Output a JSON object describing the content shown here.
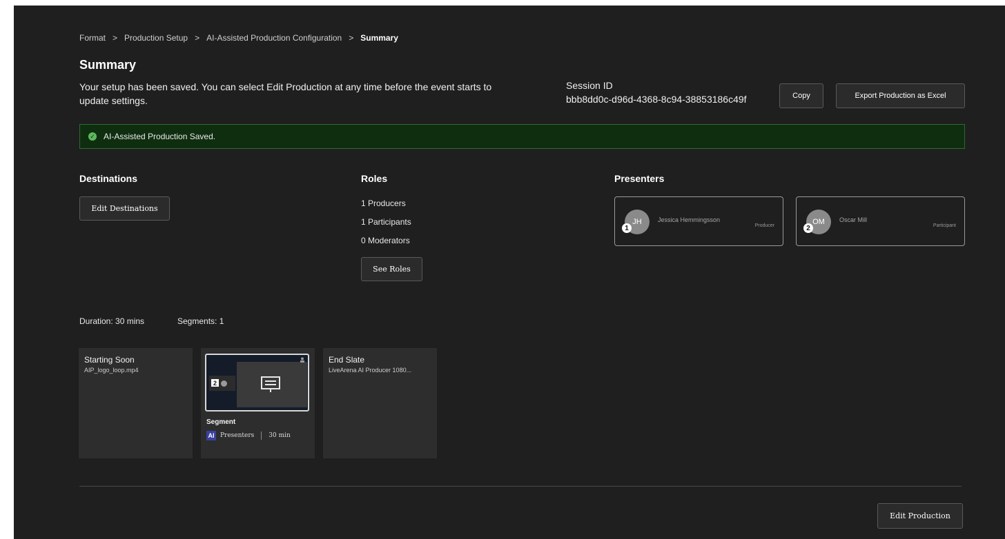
{
  "breadcrumb": [
    "Format",
    "Production Setup",
    "AI-Assisted Production Configuration",
    "Summary"
  ],
  "breadcrumb_separator": ">",
  "page_title": "Summary",
  "intro_text": "Your setup has been saved. You can select Edit Production at any time before the event starts to update settings.",
  "session": {
    "label": "Session ID",
    "id": "bbb8dd0c-d96d-4368-8c94-38853186c49f",
    "copy_label": "Copy",
    "export_label": "Export Production as Excel"
  },
  "banner": {
    "text": "AI-Assisted Production Saved.",
    "color": "#5fb85f"
  },
  "destinations": {
    "title": "Destinations",
    "edit_label": "Edit Destinations"
  },
  "roles": {
    "title": "Roles",
    "lines": [
      "1 Producers",
      "1 Participants",
      "0 Moderators"
    ],
    "see_label": "See Roles"
  },
  "presenters": {
    "title": "Presenters",
    "items": [
      {
        "number": "1",
        "initials": "JH",
        "name": "Jessica Hemmingsson",
        "role": "Producer"
      },
      {
        "number": "2",
        "initials": "OM",
        "name": "Oscar Mill",
        "role": "Participant"
      }
    ]
  },
  "summary_meta": {
    "duration": "Duration: 30 mins",
    "segments": "Segments: 1"
  },
  "tiles": {
    "starting": {
      "title": "Starting Soon",
      "subtitle": "AIP_logo_loop.mp4"
    },
    "segment": {
      "badge": "2",
      "title": "Segment",
      "ai_badge": "AI",
      "presenters": "Presenters",
      "duration": "30 min"
    },
    "end": {
      "title": "End Slate",
      "subtitle": "LiveArena AI Producer 1080..."
    }
  },
  "footer": {
    "edit_production_label": "Edit Production"
  }
}
